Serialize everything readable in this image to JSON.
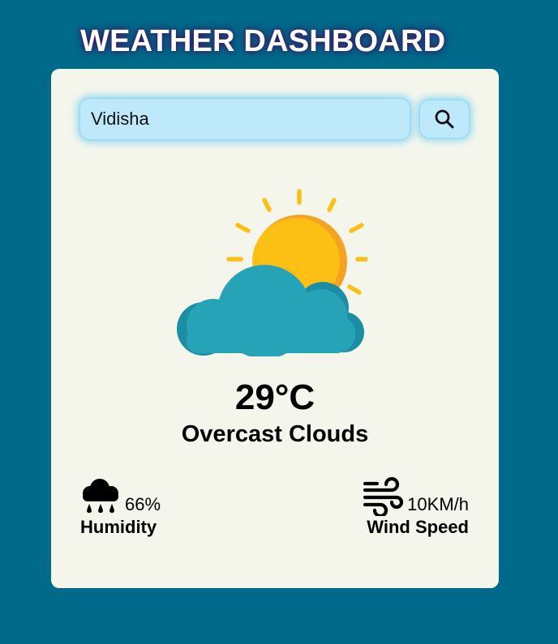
{
  "header": {
    "title": "WEATHER DASHBOARD"
  },
  "search": {
    "value": "Vidisha",
    "button_icon": "search-icon"
  },
  "weather": {
    "icon": "partly-cloudy-icon",
    "temperature": "29°C",
    "description": "Overcast Clouds"
  },
  "details": {
    "humidity": {
      "icon": "rain-cloud-icon",
      "value": "66%",
      "label": "Humidity"
    },
    "wind": {
      "icon": "wind-icon",
      "value": "10KM/h",
      "label": "Wind Speed"
    }
  },
  "colors": {
    "page_background": "#006a8a",
    "card_background": "#f4f6ec",
    "input_background": "#bde9fb",
    "sun": "#fcbf14",
    "sun_shade": "#f5a122",
    "cloud": "#27a3b8",
    "cloud_shade": "#1c8ea3"
  }
}
